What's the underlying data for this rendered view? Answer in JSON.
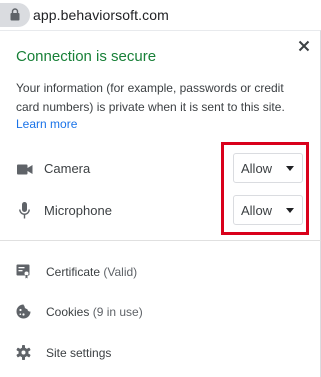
{
  "address_bar": {
    "url": "app.behaviorsoft.com"
  },
  "popup": {
    "title": "Connection is secure",
    "description": "Your information (for example, passwords or credit card numbers) is private when it is sent to this site.",
    "learn_more": "Learn more",
    "permissions": [
      {
        "label": "Camera",
        "value": "Allow"
      },
      {
        "label": "Microphone",
        "value": "Allow"
      }
    ],
    "links": [
      {
        "label": "Certificate",
        "sub": "(Valid)"
      },
      {
        "label": "Cookies",
        "sub": "(9 in use)"
      },
      {
        "label": "Site settings",
        "sub": ""
      }
    ]
  },
  "colors": {
    "secure_green": "#188038",
    "link_blue": "#1a73e8",
    "highlight_red": "#d9001b"
  },
  "icons": {
    "address": "lock-icon",
    "close": "close-icon",
    "camera": "camera-icon",
    "microphone": "microphone-icon",
    "certificate": "certificate-icon",
    "cookies": "cookie-icon",
    "settings": "gear-icon"
  }
}
